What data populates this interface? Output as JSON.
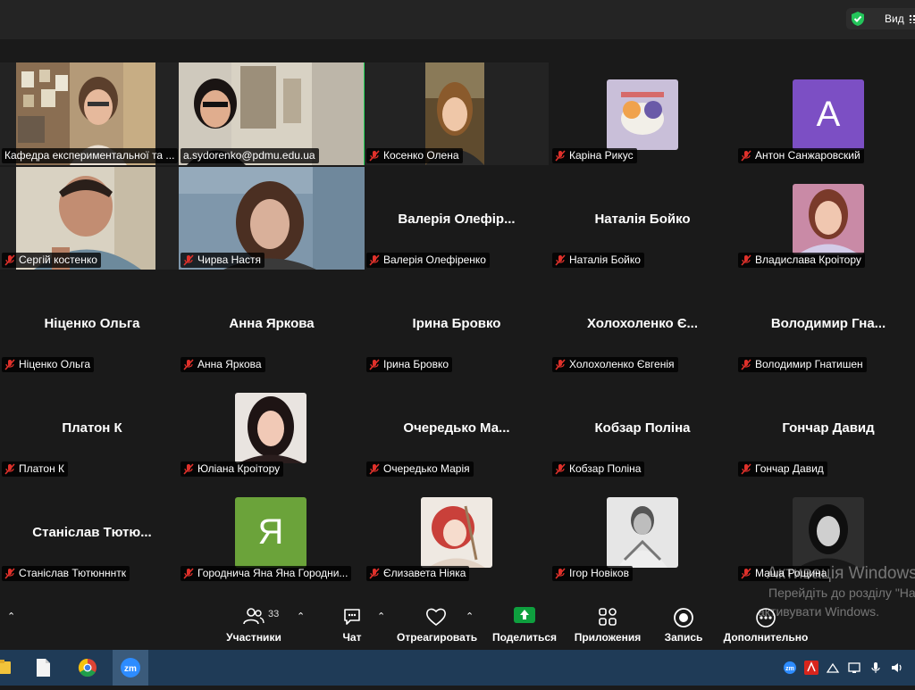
{
  "topbar": {
    "view_label": "Вид"
  },
  "tiles": [
    {
      "name": "Кафедра експериментальної та ...",
      "big": "",
      "muted": false,
      "video": "v1",
      "avatar": ""
    },
    {
      "name": "a.sydorenko@pdmu.edu.ua",
      "big": "",
      "muted": false,
      "video": "v2",
      "avatar": "",
      "active": true
    },
    {
      "name": "Косенко Олена",
      "big": "",
      "muted": true,
      "video": "v3",
      "avatar": ""
    },
    {
      "name": "Каріна Рикус",
      "big": "",
      "muted": true,
      "video": "",
      "avatar": "img-lavender"
    },
    {
      "name": "Антон Санжаровский",
      "big": "",
      "muted": true,
      "video": "",
      "avatar": "letter",
      "letter": "A",
      "letter_color": "#7c4fc4"
    },
    {
      "name": "Сергій костенко",
      "big": "",
      "muted": true,
      "video": "v4",
      "avatar": ""
    },
    {
      "name": "Чирва Настя",
      "big": "",
      "muted": true,
      "video": "v5",
      "avatar": ""
    },
    {
      "name": "Валерія Олефіренко",
      "big": "Валерія  Олефір...",
      "muted": true,
      "video": "",
      "avatar": ""
    },
    {
      "name": "Наталія Бойко",
      "big": "Наталія Бойко",
      "muted": true,
      "video": "",
      "avatar": ""
    },
    {
      "name": "Владислава Кроітору",
      "big": "",
      "muted": true,
      "video": "",
      "avatar": "img-girl-pink"
    },
    {
      "name": "Ніценко Ольга",
      "big": "Ніценко Ольга",
      "muted": true,
      "video": "",
      "avatar": ""
    },
    {
      "name": "Анна Яркова",
      "big": "Анна Яркова",
      "muted": true,
      "video": "",
      "avatar": ""
    },
    {
      "name": "Ірина Бровко",
      "big": "Ірина Бровко",
      "muted": true,
      "video": "",
      "avatar": ""
    },
    {
      "name": "Холохоленко Євгенія",
      "big": "Холохоленко Є...",
      "muted": true,
      "video": "",
      "avatar": ""
    },
    {
      "name": "Володимир Гнатишен",
      "big": "Володимир  Гна...",
      "muted": true,
      "video": "",
      "avatar": ""
    },
    {
      "name": "Платон К",
      "big": "Платон К",
      "muted": true,
      "video": "",
      "avatar": ""
    },
    {
      "name": "Юліана Кроітору",
      "big": "",
      "muted": true,
      "video": "",
      "avatar": "img-girl-dark"
    },
    {
      "name": "Очередько Марія",
      "big": "Очередько  Ма...",
      "muted": true,
      "video": "",
      "avatar": ""
    },
    {
      "name": "Кобзар Поліна",
      "big": "Кобзар Поліна",
      "muted": true,
      "video": "",
      "avatar": ""
    },
    {
      "name": "Гончар Давид",
      "big": "Гончар Давид",
      "muted": true,
      "video": "",
      "avatar": ""
    },
    {
      "name": "Станіслав Тютюнннтк",
      "big": "Станіслав  Тютю...",
      "muted": true,
      "video": "",
      "avatar": ""
    },
    {
      "name": "Городнича Яна Яна Городни...",
      "big": "",
      "muted": true,
      "video": "",
      "avatar": "letter",
      "letter": "Я",
      "letter_color": "#6ba33a"
    },
    {
      "name": "Єлизавета Ніяка",
      "big": "",
      "muted": true,
      "video": "",
      "avatar": "img-anime"
    },
    {
      "name": "Ігор Новіков",
      "big": "",
      "muted": true,
      "video": "",
      "avatar": "img-bw-boy"
    },
    {
      "name": "Маша Рощина",
      "big": "",
      "muted": true,
      "video": "",
      "avatar": "img-bw-girl"
    }
  ],
  "toolbar": {
    "participants_label": "Участники",
    "participants_count": "33",
    "chat_label": "Чат",
    "react_label": "Отреагировать",
    "share_label": "Поделиться",
    "apps_label": "Приложения",
    "record_label": "Запись",
    "more_label": "Дополнительно"
  },
  "watermark": {
    "line1": "Активація Windows",
    "line2": "Перейдіть до розділу \"Налаштування\", щоб",
    "line3": "активувати Windows."
  },
  "colors": {
    "active_speaker": "#23d959",
    "share_green": "#0e9f3e",
    "taskbar": "#1f3b57",
    "mute_red": "#e0312b"
  }
}
